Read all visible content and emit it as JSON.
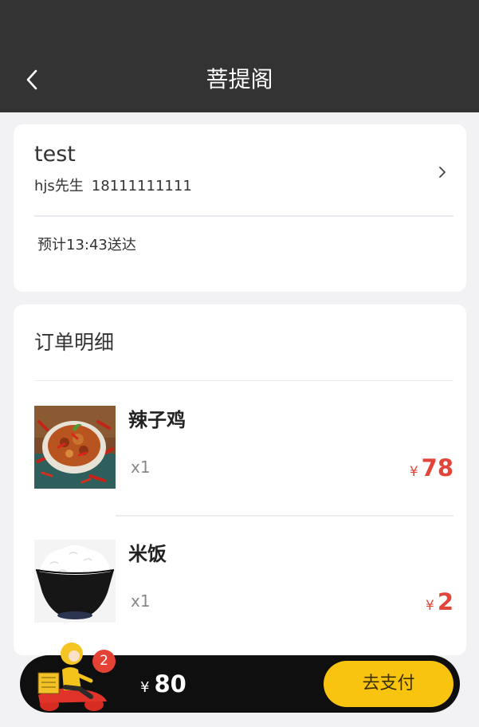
{
  "header": {
    "title": "菩提阁",
    "back_icon": "chevron-left-icon"
  },
  "address": {
    "name": "test",
    "contact_name": "hjs先生",
    "phone": "18111111111",
    "chevron_icon": "chevron-right-icon",
    "eta": "预计13:43送达"
  },
  "order": {
    "title": "订单明细",
    "items": [
      {
        "name": "辣子鸡",
        "qty": "x1",
        "currency": "¥",
        "price": "78"
      },
      {
        "name": "米饭",
        "qty": "x1",
        "currency": "¥",
        "price": "2"
      }
    ]
  },
  "cart": {
    "badge_count": "2",
    "currency": "¥",
    "total": "80",
    "pay_label": "去支付"
  },
  "colors": {
    "header_bg": "#333333",
    "price_red": "#e2453a",
    "pay_yellow": "#f9c40f",
    "cart_bg": "#0f0f0f",
    "badge_red": "#e44235"
  }
}
